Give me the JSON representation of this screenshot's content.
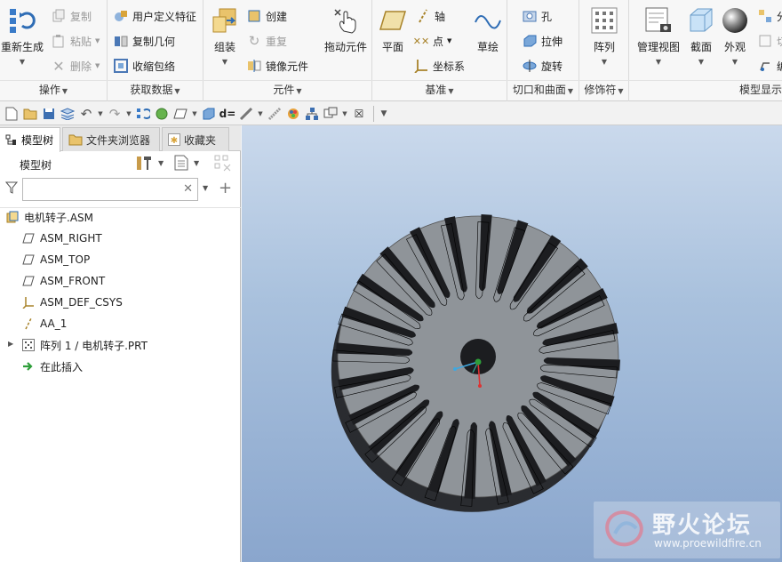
{
  "ribbon": {
    "operations": {
      "label": "操作",
      "regenerate": "重新生成",
      "copy": "复制",
      "paste": "粘贴",
      "delete": "删除"
    },
    "get_data": {
      "label": "获取数据",
      "user_defined_feature": "用户定义特征",
      "copy_geometry": "复制几何",
      "shrinkwrap": "收缩包络"
    },
    "component": {
      "label": "元件",
      "assemble": "组装",
      "create": "创建",
      "repeat": "重复",
      "mirror_component": "镜像元件",
      "drag_component": "拖动元件"
    },
    "datum": {
      "label": "基准",
      "plane": "平面",
      "axis": "轴",
      "point": "点",
      "csys": "坐标系",
      "sketch": "草绘"
    },
    "cut_surface": {
      "label": "切口和曲面",
      "hole": "孔",
      "extrude": "拉伸",
      "revolve": "旋转"
    },
    "modifiers": {
      "label": "修饰符",
      "pattern": "阵列"
    },
    "model_display": {
      "label": "模型显示",
      "manage_views": "管理视图",
      "section": "截面",
      "appearance": "外观",
      "clip1": "分",
      "clip2": "切",
      "clip3": "编"
    }
  },
  "left_panel": {
    "tabs": [
      {
        "label": "模型树"
      },
      {
        "label": "文件夹浏览器"
      },
      {
        "label": "收藏夹"
      }
    ],
    "title": "模型树",
    "search": {
      "value": "",
      "placeholder": ""
    },
    "tree": [
      {
        "label": "电机转子.ASM",
        "icon": "assembly-icon"
      },
      {
        "label": "ASM_RIGHT",
        "icon": "datum-plane-icon"
      },
      {
        "label": "ASM_TOP",
        "icon": "datum-plane-icon"
      },
      {
        "label": "ASM_FRONT",
        "icon": "datum-plane-icon"
      },
      {
        "label": "ASM_DEF_CSYS",
        "icon": "csys-icon"
      },
      {
        "label": "AA_1",
        "icon": "datum-axis-icon"
      },
      {
        "label": "阵列 1 / 电机转子.PRT",
        "icon": "pattern-icon"
      },
      {
        "label": "在此插入",
        "icon": "insert-arrow-icon"
      }
    ]
  },
  "rotor": {
    "slots": 24,
    "colors": {
      "face": "#8f9499",
      "side": "#2a2c30",
      "slot": "#1c1d20"
    }
  },
  "watermark": {
    "text": "野火论坛",
    "url": "www.proewildfire.cn"
  },
  "colors": {
    "viewport_top": "#cad9ec",
    "viewport_bottom": "#8aa6cd",
    "accent": "#2f6db5"
  }
}
